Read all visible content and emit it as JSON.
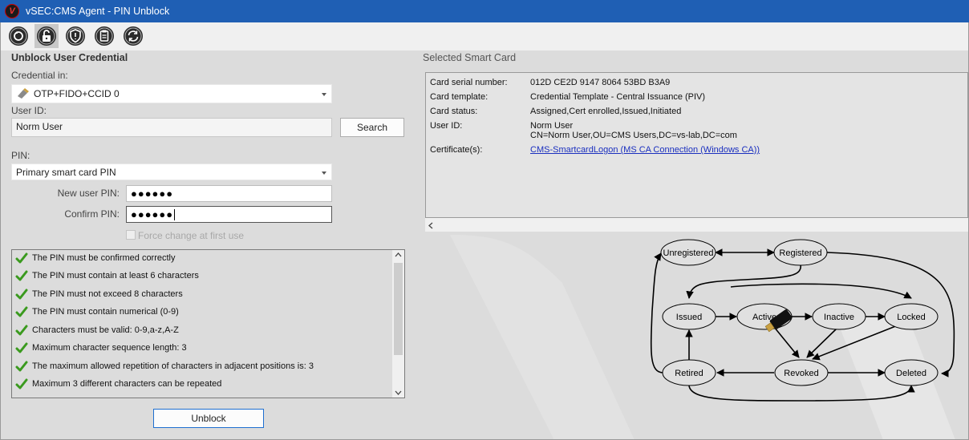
{
  "window": {
    "title": "vSEC:CMS Agent - PIN Unblock",
    "logo": "V"
  },
  "toolbar": {
    "icons": [
      "refresh-card-icon",
      "unblock-lock-icon",
      "shield-icon",
      "clipboard-icon",
      "sync-icon"
    ],
    "active_index": 1
  },
  "left": {
    "section_title": "Unblock User Credential",
    "credential_label": "Credential in:",
    "credential_value": "OTP+FIDO+CCID 0",
    "user_id_label": "User ID:",
    "user_id_value": "Norm User",
    "search_label": "Search",
    "pin_label": "PIN:",
    "pin_type_value": "Primary smart card PIN",
    "new_pin_label": "New user PIN:",
    "new_pin_value": "●●●●●●",
    "confirm_pin_label": "Confirm PIN:",
    "confirm_pin_value": "●●●●●●",
    "force_change_label": "Force change at first use",
    "force_change_checked": false,
    "rules": [
      "The PIN must be confirmed correctly",
      "The PIN must contain at least 6 characters",
      "The PIN must not exceed 8 characters",
      "The PIN must contain numerical (0-9)",
      "Characters must be valid: 0-9,a-z,A-Z",
      "Maximum character sequence length: 3",
      "The maximum allowed repetition of characters in adjacent positions is: 3",
      "Maximum 3 different characters can be repeated"
    ],
    "unblock_label": "Unblock"
  },
  "right": {
    "section_title": "Selected Smart Card",
    "details": {
      "serial_key": "Card serial number:",
      "serial_value": "012D CE2D 9147 8064 53BD B3A9",
      "template_key": "Card template:",
      "template_value": "Credential Template - Central Issuance (PIV)",
      "status_key": "Card status:",
      "status_value": "Assigned,Cert enrolled,Issued,Initiated",
      "user_key": "User ID:",
      "user_value_1": "Norm User",
      "user_value_2": "CN=Norm User,OU=CMS Users,DC=vs-lab,DC=com",
      "cert_key": "Certificate(s):",
      "cert_value": "CMS-SmartcardLogon (MS CA Connection (Windows CA))"
    },
    "states": {
      "unregistered": "Unregistered",
      "registered": "Registered",
      "issued": "Issued",
      "active": "Active",
      "inactive": "Inactive",
      "locked": "Locked",
      "retired": "Retired",
      "revoked": "Revoked",
      "deleted": "Deleted"
    },
    "current_state": "Active"
  },
  "colors": {
    "titlebar": "#1f5fb4",
    "check": "#3a9a1e",
    "link": "#1a2fbf"
  }
}
